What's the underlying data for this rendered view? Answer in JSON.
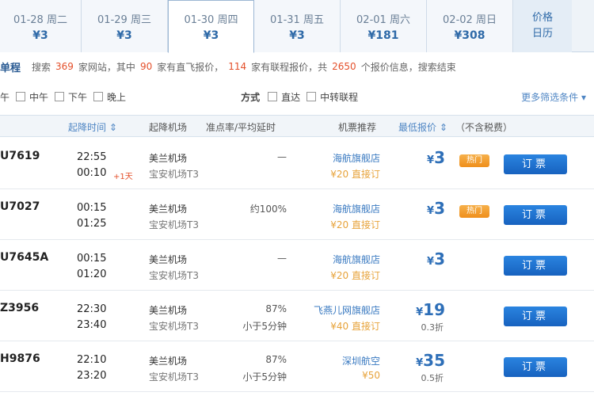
{
  "date_tabs": [
    {
      "date": "01-28 周二",
      "price": "¥3"
    },
    {
      "date": "01-29 周三",
      "price": "¥3"
    },
    {
      "date": "01-30 周四",
      "price": "¥3"
    },
    {
      "date": "01-31 周五",
      "price": "¥3"
    },
    {
      "date": "02-01 周六",
      "price": "¥181"
    },
    {
      "date": "02-02 周日",
      "price": "¥308"
    }
  ],
  "calendar_tab": {
    "line1": "价格",
    "line2": "日历"
  },
  "summary": {
    "tag": "单程",
    "t1": "搜索",
    "sites": "369",
    "t2": "家网站，其中",
    "direct": "90",
    "t3": "家有直飞报价，",
    "combo": "114",
    "t4": "家有联程报价，共",
    "total": "2650",
    "t5": "个报价信息，搜索结束"
  },
  "filters": {
    "times": [
      "午",
      "中午",
      "下午",
      "晚上"
    ],
    "mode_label": "方式",
    "modes": [
      "直达",
      "中转联程"
    ],
    "more": "更多筛选条件 ▾"
  },
  "header": {
    "dep_time": "起降时间 ⇕",
    "airport": "起降机场",
    "punctuality": "准点率/平均延时",
    "recommend": "机票推荐",
    "lowest": "最低报价 ⇕",
    "tax": "（不含税费）"
  },
  "flights": [
    {
      "no": "U7619",
      "dep": "22:55",
      "arr": "00:10",
      "plus": "+1天",
      "apt1": "美兰机场",
      "apt2": "宝安机场T3",
      "punc1": "—",
      "punc2": "",
      "shop": "海航旗舰店",
      "book": "¥20 直接订",
      "price": "3",
      "disc": "",
      "hot": "热门",
      "btn": "订票"
    },
    {
      "no": "U7027",
      "dep": "00:15",
      "arr": "01:25",
      "plus": "",
      "apt1": "美兰机场",
      "apt2": "宝安机场T3",
      "punc1": "约100%",
      "punc2": "",
      "shop": "海航旗舰店",
      "book": "¥20 直接订",
      "price": "3",
      "disc": "",
      "hot": "热门",
      "btn": "订票"
    },
    {
      "no": "U7645A",
      "dep": "00:15",
      "arr": "01:20",
      "plus": "",
      "apt1": "美兰机场",
      "apt2": "宝安机场T3",
      "punc1": "—",
      "punc2": "",
      "shop": "海航旗舰店",
      "book": "¥20 直接订",
      "price": "3",
      "disc": "",
      "hot": "",
      "btn": "订票"
    },
    {
      "no": "Z3956",
      "dep": "22:30",
      "arr": "23:40",
      "plus": "",
      "apt1": "美兰机场",
      "apt2": "宝安机场T3",
      "punc1": "87%",
      "punc2": "小于5分钟",
      "shop": "飞燕儿网旗舰店",
      "book": "¥40 直接订",
      "price": "19",
      "disc": "0.3折",
      "hot": "",
      "btn": "订票"
    },
    {
      "no": "H9876",
      "dep": "22:10",
      "arr": "23:20",
      "plus": "",
      "apt1": "美兰机场",
      "apt2": "宝安机场T3",
      "punc1": "87%",
      "punc2": "小于5分钟",
      "shop": "深圳航空",
      "book": "¥50",
      "price": "35",
      "disc": "0.5折",
      "hot": "",
      "btn": "订票"
    }
  ],
  "currency": "¥"
}
